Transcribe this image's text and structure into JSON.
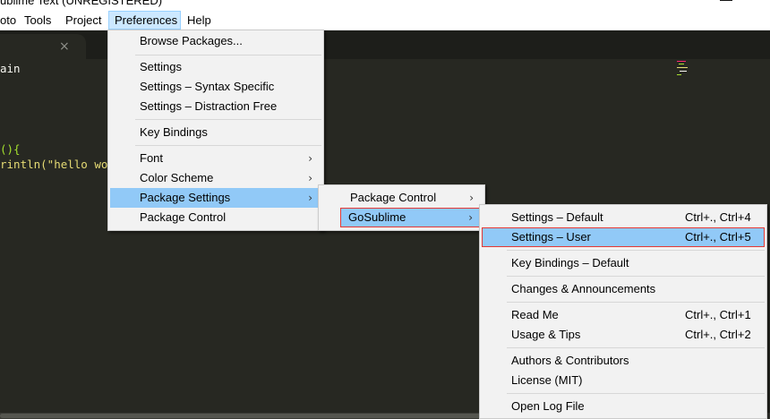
{
  "window": {
    "title": "ublime Text (UNREGISTERED)",
    "minimize_glyph": "—"
  },
  "menubar": {
    "items": [
      "oto",
      "Tools",
      "Project",
      "Preferences",
      "Help"
    ]
  },
  "tab": {
    "close_glyph": "×"
  },
  "editor": {
    "lines": [
      "ain",
      "(){",
      "rintln(\"hello wor"
    ]
  },
  "preferences_menu": {
    "items": [
      {
        "label": "Browse Packages..."
      },
      {
        "label": "Settings"
      },
      {
        "label": "Settings – Syntax Specific"
      },
      {
        "label": "Settings – Distraction Free"
      },
      {
        "label": "Key Bindings"
      },
      {
        "label": "Font",
        "submenu": true
      },
      {
        "label": "Color Scheme",
        "submenu": true
      },
      {
        "label": "Package Settings",
        "submenu": true,
        "highlighted": true
      },
      {
        "label": "Package Control"
      }
    ]
  },
  "package_settings_menu": {
    "items": [
      {
        "label": "Package Control",
        "submenu": true
      },
      {
        "label": "GoSublime",
        "submenu": true,
        "highlighted": true
      }
    ]
  },
  "gosublime_menu": {
    "items": [
      {
        "label": "Settings – Default",
        "shortcut": "Ctrl+., Ctrl+4"
      },
      {
        "label": "Settings – User",
        "shortcut": "Ctrl+., Ctrl+5",
        "highlighted": true
      },
      {
        "label": "Key Bindings – Default",
        "shortcut": ""
      },
      {
        "label": "Changes & Announcements",
        "shortcut": ""
      },
      {
        "label": "Read Me",
        "shortcut": "Ctrl+., Ctrl+1"
      },
      {
        "label": "Usage & Tips",
        "shortcut": "Ctrl+., Ctrl+2"
      },
      {
        "label": "Authors & Contributors",
        "shortcut": ""
      },
      {
        "label": "License (MIT)",
        "shortcut": ""
      },
      {
        "label": "Open Log File",
        "shortcut": ""
      }
    ]
  },
  "icons": {
    "submenu_arrow": "›"
  },
  "colors": {
    "editor_bg": "#272822",
    "menu_bg": "#f2f2f2",
    "menu_highlight": "#91c9f7",
    "menubar_active": "#cce8ff",
    "annotation_red": "#e53935",
    "code_green": "#a6e22e",
    "code_yellow": "#e6db74",
    "code_text": "#f8f8f2"
  }
}
